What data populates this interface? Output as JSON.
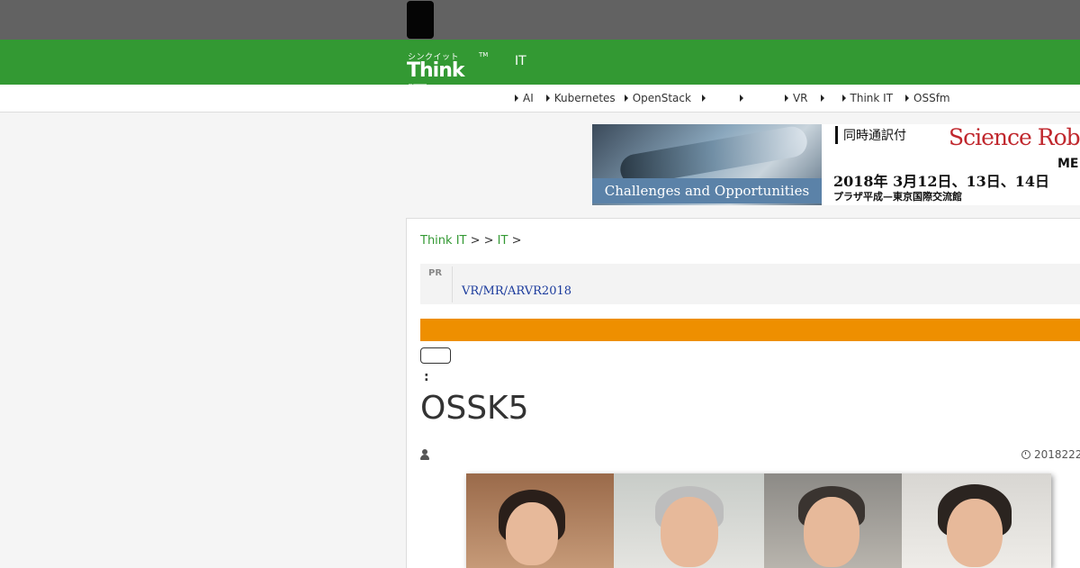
{
  "header": {
    "logo_kana": "シンクイット",
    "logo_brand": "Think IT",
    "logo_tm": "TM",
    "title": "IT"
  },
  "nav": {
    "items": [
      "AI",
      "Kubernetes",
      "OpenStack",
      "",
      "",
      "VR",
      "",
      "Think IT",
      "OSSfm"
    ]
  },
  "banner": {
    "caption": "Challenges and Opportunities",
    "jp_line1": "同時通訳付",
    "science": "Science Roboti",
    "me": "ME",
    "date": "2018年 3月12日、13日、14日",
    "venue": "プラザ平成—東京国際交流館"
  },
  "breadcrumb": {
    "home": "Think IT",
    "sep1": " > ",
    "sep2": " > ",
    "item2": "IT",
    "sep3": " >"
  },
  "pr": {
    "label": "PR",
    "link_text": "VR/MR/ARVR2018"
  },
  "article": {
    "colon": ":",
    "title": "OSSK5",
    "date": "2018222"
  },
  "colors": {
    "topbar": "#626262",
    "header_green": "#339933",
    "accent_orange": "#ee8f00",
    "link_blue": "#1a3a9c"
  }
}
